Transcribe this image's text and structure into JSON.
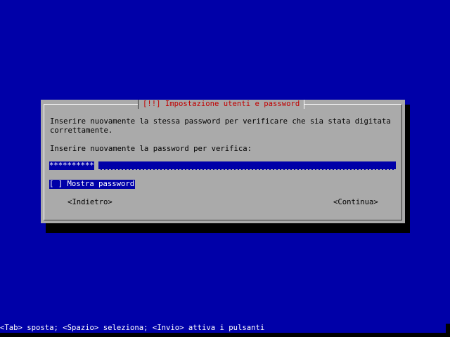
{
  "dialog": {
    "title": "[!!] Impostazione utenti e password",
    "description_line1": "Inserire nuovamente la stessa password per verificare che sia stata digitata",
    "description_line2": "correttamente.",
    "prompt": "Inserire nuovamente la password per verifica:",
    "password_value": "**********",
    "show_password_checkbox": {
      "label": "[ ] Mostra password",
      "checked": false
    },
    "back_button": "<Indietro>",
    "continue_button": "<Continua>"
  },
  "status_bar": "<Tab> sposta; <Spazio> seleziona; <Invio> attiva i pulsanti",
  "colors": {
    "background": "#0000a8",
    "dialog": "#aaaaaa",
    "title": "#c00000",
    "highlight": "#0000a8"
  }
}
